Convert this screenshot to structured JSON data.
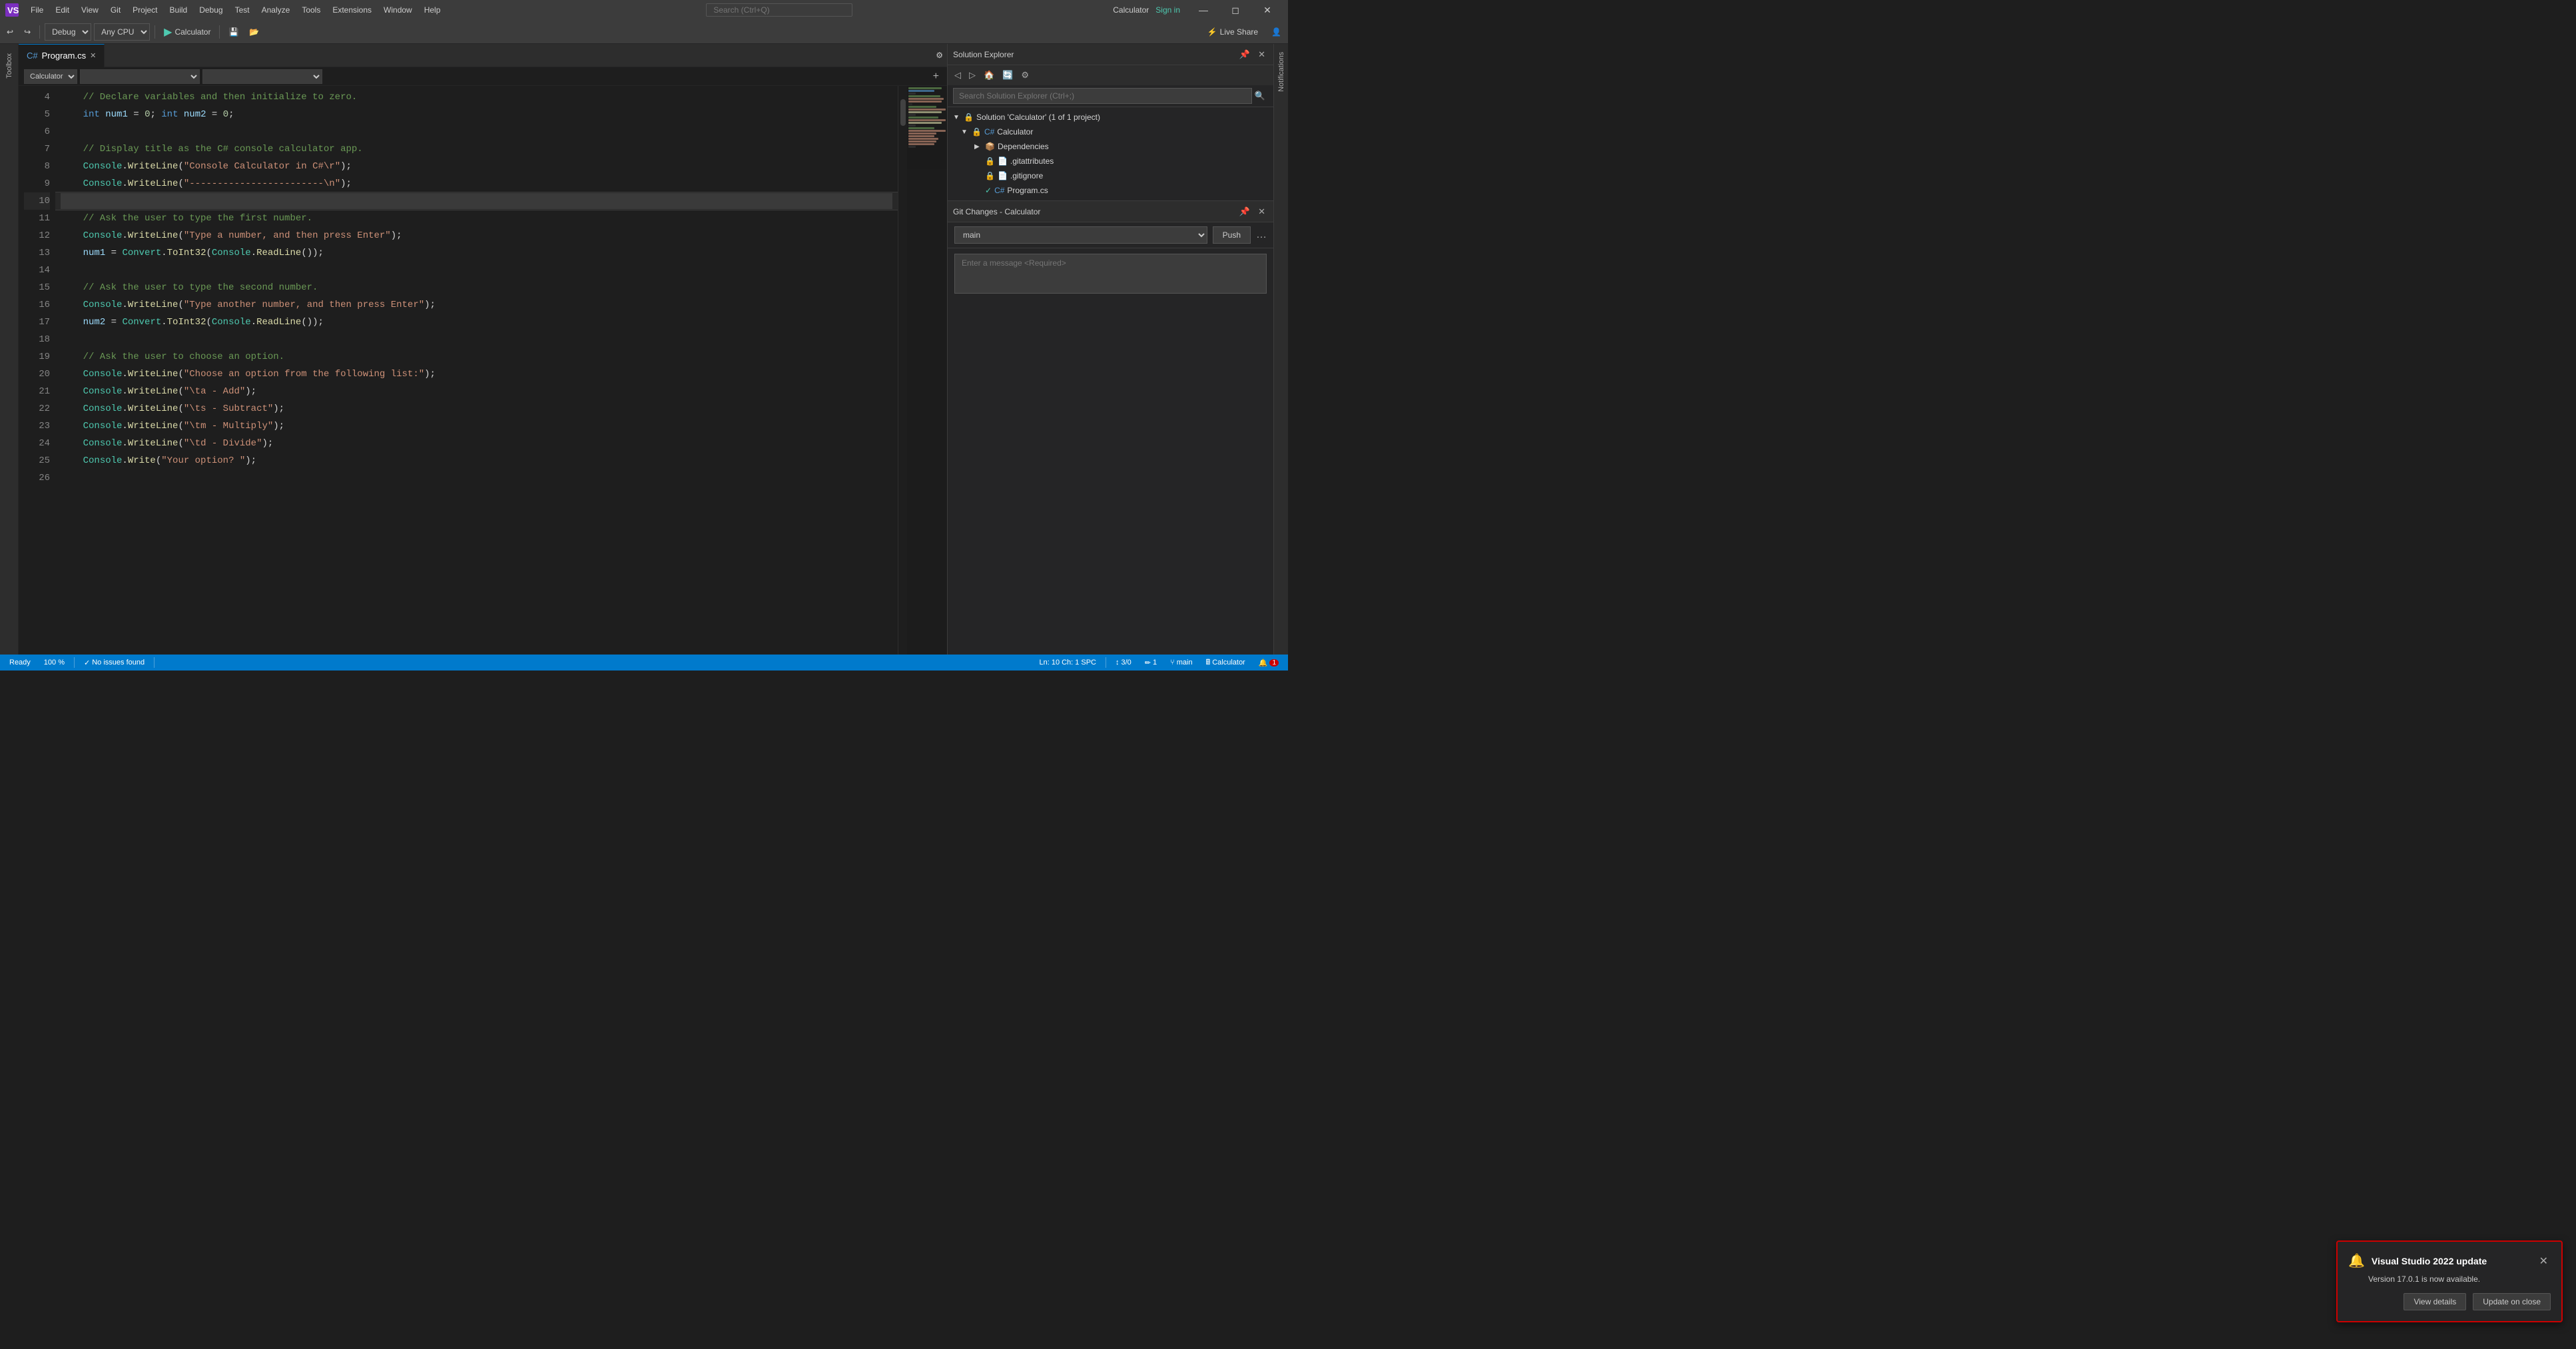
{
  "window": {
    "title": "Calculator",
    "sign_in": "Sign in"
  },
  "menu": {
    "items": [
      "File",
      "Edit",
      "View",
      "Git",
      "Project",
      "Build",
      "Debug",
      "Test",
      "Analyze",
      "Tools",
      "Extensions",
      "Window",
      "Help"
    ]
  },
  "toolbar": {
    "config": "Debug",
    "platform": "Any CPU",
    "run_label": "Calculator",
    "live_share": "Live Share"
  },
  "tabs": [
    {
      "label": "Program.cs",
      "active": true
    }
  ],
  "nav": {
    "class_selector": "Calculator",
    "method_selector": ""
  },
  "code": {
    "lines": [
      {
        "num": 4,
        "content": "    // Declare variables and then initialize to zero.",
        "type": "comment"
      },
      {
        "num": 5,
        "content": "    int num1 = 0; int num2 = 0;",
        "type": "code"
      },
      {
        "num": 6,
        "content": "",
        "type": "empty"
      },
      {
        "num": 7,
        "content": "    // Display title as the C# console calculator app.",
        "type": "comment"
      },
      {
        "num": 8,
        "content": "    Console.WriteLine(\"Console Calculator in C#\\r\");",
        "type": "code"
      },
      {
        "num": 9,
        "content": "    Console.WriteLine(\"------------------------\\n\");",
        "type": "code"
      },
      {
        "num": 10,
        "content": "",
        "type": "active"
      },
      {
        "num": 11,
        "content": "    // Ask the user to type the first number.",
        "type": "comment"
      },
      {
        "num": 12,
        "content": "    Console.WriteLine(\"Type a number, and then press Enter\");",
        "type": "code"
      },
      {
        "num": 13,
        "content": "    num1 = Convert.ToInt32(Console.ReadLine());",
        "type": "code"
      },
      {
        "num": 14,
        "content": "",
        "type": "empty"
      },
      {
        "num": 15,
        "content": "    // Ask the user to type the second number.",
        "type": "comment"
      },
      {
        "num": 16,
        "content": "    Console.WriteLine(\"Type another number, and then press Enter\");",
        "type": "code"
      },
      {
        "num": 17,
        "content": "    num2 = Convert.ToInt32(Console.ReadLine());",
        "type": "code"
      },
      {
        "num": 18,
        "content": "",
        "type": "empty"
      },
      {
        "num": 19,
        "content": "    // Ask the user to choose an option.",
        "type": "comment"
      },
      {
        "num": 20,
        "content": "    Console.WriteLine(\"Choose an option from the following list:\");",
        "type": "code"
      },
      {
        "num": 21,
        "content": "    Console.WriteLine(\"\\ta - Add\");",
        "type": "code"
      },
      {
        "num": 22,
        "content": "    Console.WriteLine(\"\\ts - Subtract\");",
        "type": "code"
      },
      {
        "num": 23,
        "content": "    Console.WriteLine(\"\\tm - Multiply\");",
        "type": "code"
      },
      {
        "num": 24,
        "content": "    Console.WriteLine(\"\\td - Divide\");",
        "type": "code"
      },
      {
        "num": 25,
        "content": "    Console.Write(\"Your option? \");",
        "type": "code"
      },
      {
        "num": 26,
        "content": "",
        "type": "empty"
      }
    ]
  },
  "solution_explorer": {
    "title": "Solution Explorer",
    "search_placeholder": "Search Solution Explorer (Ctrl+;)",
    "tree": [
      {
        "level": 0,
        "label": "Solution 'Calculator' (1 of 1 project)",
        "icon": "📄",
        "expanded": true
      },
      {
        "level": 1,
        "label": "Calculator",
        "icon": "📁",
        "expanded": true
      },
      {
        "level": 2,
        "label": "Dependencies",
        "icon": "📦",
        "expanded": false
      },
      {
        "level": 2,
        "label": ".gitattributes",
        "icon": "📄"
      },
      {
        "level": 2,
        "label": ".gitignore",
        "icon": "📄"
      },
      {
        "level": 2,
        "label": "Program.cs",
        "icon": "📄",
        "active": true
      }
    ]
  },
  "git_changes": {
    "title": "Git Changes - Calculator",
    "branch": "main",
    "push_label": "Push",
    "message_placeholder": "Enter a message <Required>"
  },
  "status_bar": {
    "zoom": "100 %",
    "issues": "No issues found",
    "position": "Ln: 10",
    "column": "Ch: 1",
    "encoding": "SPC",
    "git_changes": "3/0",
    "pen_icon": "1",
    "branch": "main",
    "project": "Calculator",
    "notification_count": "1",
    "ready": "Ready"
  },
  "notification": {
    "title": "Visual Studio 2022 update",
    "body": "Version 17.0.1 is now available.",
    "view_details": "View details",
    "update_on_close": "Update on close"
  }
}
